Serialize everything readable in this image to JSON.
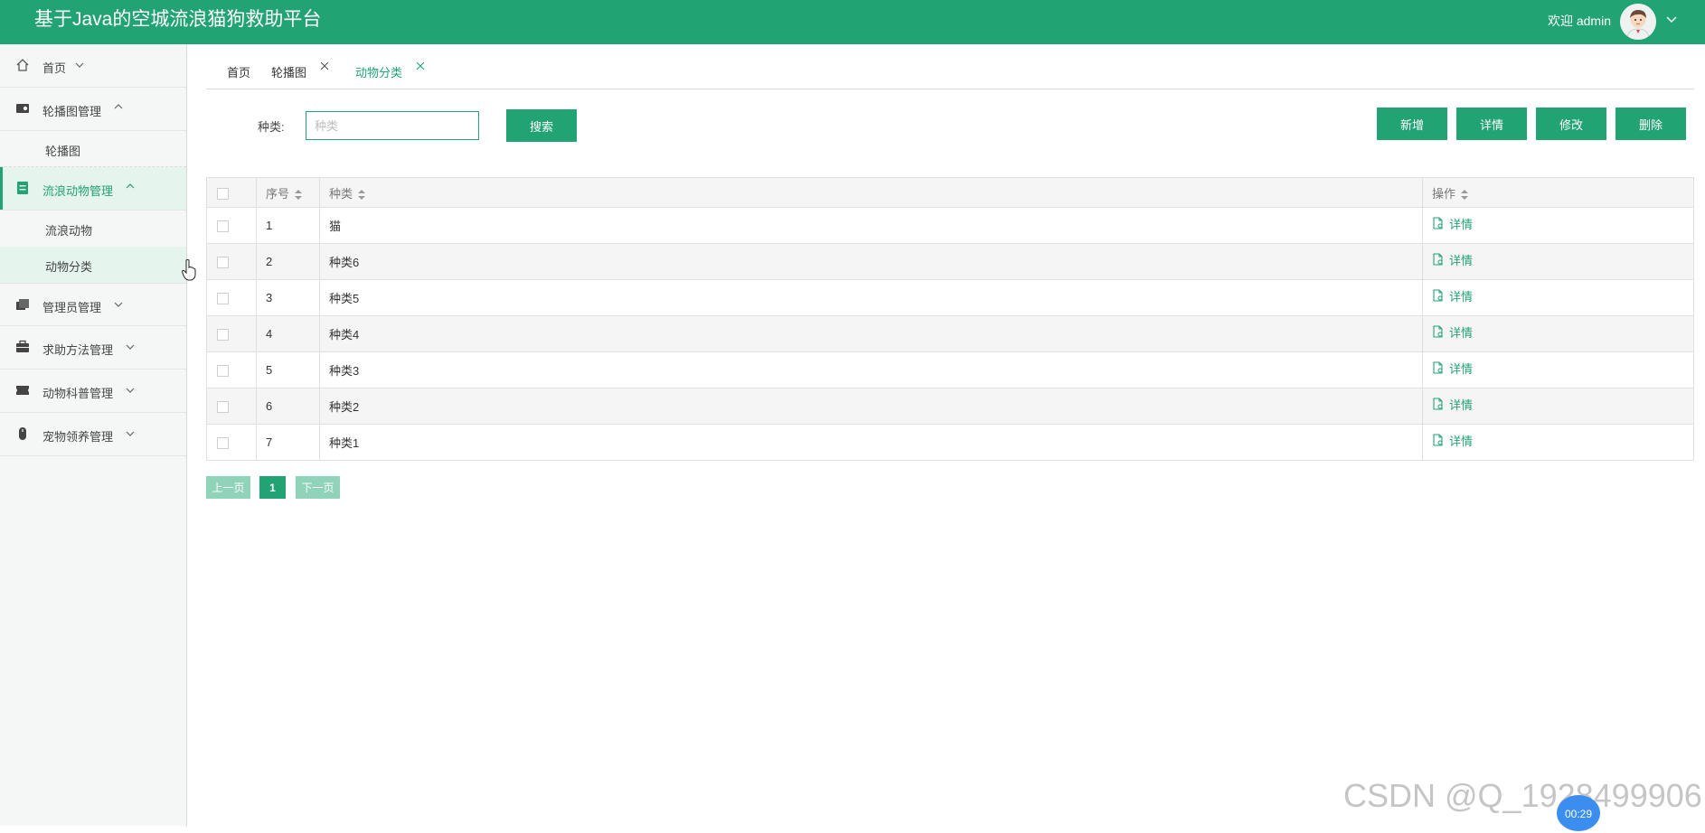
{
  "header": {
    "title": "基于Java的空城流浪猫狗救助平台",
    "welcome": "欢迎 admin",
    "color": "#22a373"
  },
  "sidebar": {
    "items": [
      {
        "label": "首页",
        "icon": "home-icon"
      },
      {
        "label": "轮播图管理",
        "icon": "carousel-icon",
        "children": [
          {
            "label": "轮播图"
          }
        ]
      },
      {
        "label": "流浪动物管理",
        "icon": "list-icon",
        "active": true,
        "children": [
          {
            "label": "流浪动物"
          },
          {
            "label": "动物分类",
            "active": true
          }
        ]
      },
      {
        "label": "管理员管理",
        "icon": "folder-icon"
      },
      {
        "label": "求助方法管理",
        "icon": "briefcase-icon"
      },
      {
        "label": "动物科普管理",
        "icon": "ticket-icon"
      },
      {
        "label": "宠物领养管理",
        "icon": "mouse-icon"
      }
    ]
  },
  "tabs": [
    {
      "label": "首页"
    },
    {
      "label": "轮播图",
      "closable": true
    },
    {
      "label": "动物分类",
      "closable": true,
      "current": true
    }
  ],
  "search": {
    "label": "种类:",
    "placeholder": "种类",
    "button": "搜索"
  },
  "actions": {
    "add": "新增",
    "detail": "详情",
    "edit": "修改",
    "delete": "删除"
  },
  "table": {
    "headers": {
      "no": "序号",
      "type": "种类",
      "op": "操作"
    },
    "op_label": "详情",
    "rows": [
      {
        "no": "1",
        "type": "猫"
      },
      {
        "no": "2",
        "type": "种类6"
      },
      {
        "no": "3",
        "type": "种类5"
      },
      {
        "no": "4",
        "type": "种类4"
      },
      {
        "no": "5",
        "type": "种类3"
      },
      {
        "no": "6",
        "type": "种类2"
      },
      {
        "no": "7",
        "type": "种类1"
      }
    ]
  },
  "pagination": {
    "prev": "上一页",
    "current": "1",
    "next": "下一页"
  },
  "watermark": "CSDN @Q_1928499906",
  "timer": "00:29"
}
